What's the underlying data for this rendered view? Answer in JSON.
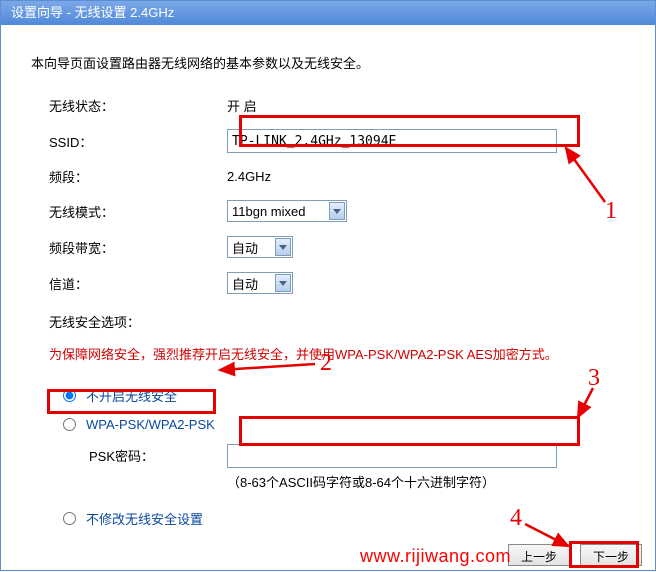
{
  "title": "设置向导 - 无线设置 2.4GHz",
  "intro": "本向导页面设置路由器无线网络的基本参数以及无线安全。",
  "labels": {
    "wireless_status": "无线状态：",
    "ssid": "SSID：",
    "band": "频段：",
    "wireless_mode": "无线模式：",
    "channel_width": "频段带宽：",
    "channel": "信道：",
    "security_heading": "无线安全选项：",
    "psk_label": "PSK密码："
  },
  "values": {
    "wireless_status": "开 启",
    "ssid": "TP-LINK_2.4GHz_13094E",
    "band": "2.4GHz",
    "wireless_mode": "11bgn mixed",
    "channel_width": "自动",
    "channel": "自动",
    "psk": ""
  },
  "warning": "为保障网络安全，强烈推荐开启无线安全，并使用WPA-PSK/WPA2-PSK AES加密方式。",
  "radios": {
    "disable_security": "不开启无线安全",
    "wpa_psk": "WPA-PSK/WPA2-PSK",
    "no_change": "不修改无线安全设置"
  },
  "psk_hint": "（8-63个ASCII码字符或8-64个十六进制字符）",
  "buttons": {
    "prev": "上一步",
    "next": "下一步"
  },
  "annotations": {
    "n1": "1",
    "n2": "2",
    "n3": "3",
    "n4": "4"
  },
  "watermark": "www.rijiwang.com"
}
